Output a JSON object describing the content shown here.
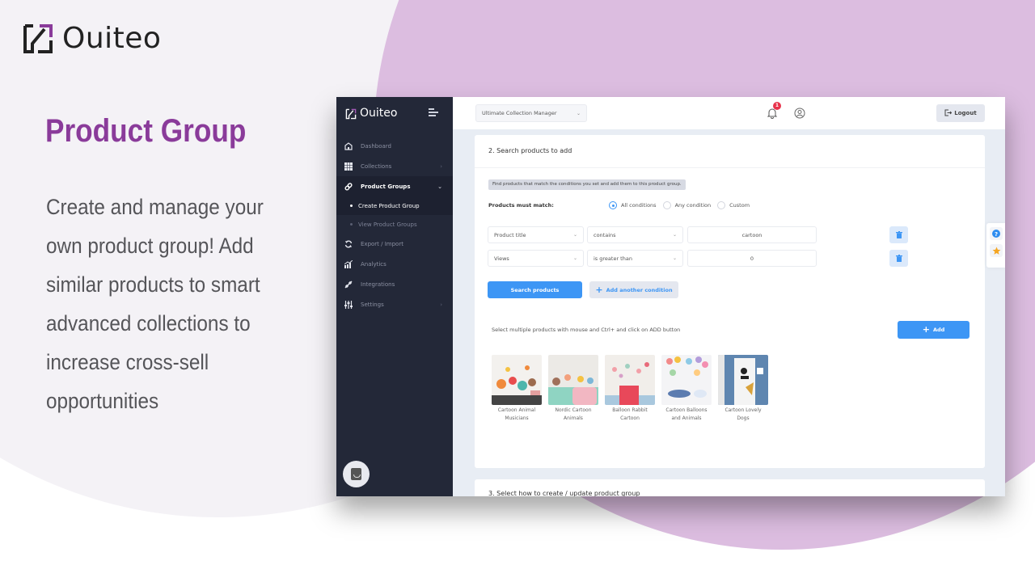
{
  "brand": {
    "name": "Ouiteo",
    "accent": "#8a3b9a"
  },
  "hero": {
    "title": "Product Group",
    "description": "Create and manage your own product group! Add similar products to smart advanced collections to increase cross-sell opportunities"
  },
  "app": {
    "sidebar": {
      "brand": "Ouiteo",
      "items": [
        {
          "label": "Dashboard",
          "icon": "home-icon"
        },
        {
          "label": "Collections",
          "icon": "grid-icon",
          "has_chevron": true
        },
        {
          "label": "Product Groups",
          "icon": "link-icon",
          "active": true,
          "expanded": true,
          "children": [
            {
              "label": "Create Product Group",
              "active": true
            },
            {
              "label": "View Product Groups"
            }
          ]
        },
        {
          "label": "Export / Import",
          "icon": "sync-icon"
        },
        {
          "label": "Analytics",
          "icon": "analytics-icon"
        },
        {
          "label": "Integrations",
          "icon": "plug-icon"
        },
        {
          "label": "Settings",
          "icon": "sliders-icon",
          "has_chevron": true
        }
      ]
    },
    "topbar": {
      "app_select": "Ultimate Collection Manager",
      "notification_count": "1",
      "logout_label": "Logout"
    },
    "search_section": {
      "title": "2. Search products to add",
      "info": "Find products that match the conditions you set and add them to this product group.",
      "match_label": "Products must match:",
      "match_options": [
        "All conditions",
        "Any condition",
        "Custom"
      ],
      "match_selected": "All conditions",
      "conditions": [
        {
          "field": "Product title",
          "operator": "contains",
          "value": "cartoon"
        },
        {
          "field": "Views",
          "operator": "is greater than",
          "value": "0"
        }
      ],
      "search_button": "Search products",
      "add_condition_button": "Add another condition",
      "select_hint": "Select multiple products with mouse and Ctrl+ and click on ADD button",
      "add_button": "Add",
      "products": [
        {
          "name": "Cartoon Animal Musicians"
        },
        {
          "name": "Nordic Cartoon Animals"
        },
        {
          "name": "Balloon Rabbit Cartoon"
        },
        {
          "name": "Cartoon Balloons and Animals"
        },
        {
          "name": "Cartoon Lovely Dogs"
        }
      ]
    },
    "next_section": {
      "title": "3. Select how to create / update product group"
    },
    "colors": {
      "primary": "#3d96f5",
      "sidebar_bg": "#232838",
      "badge": "#e8334b",
      "star": "#f5a623"
    }
  }
}
